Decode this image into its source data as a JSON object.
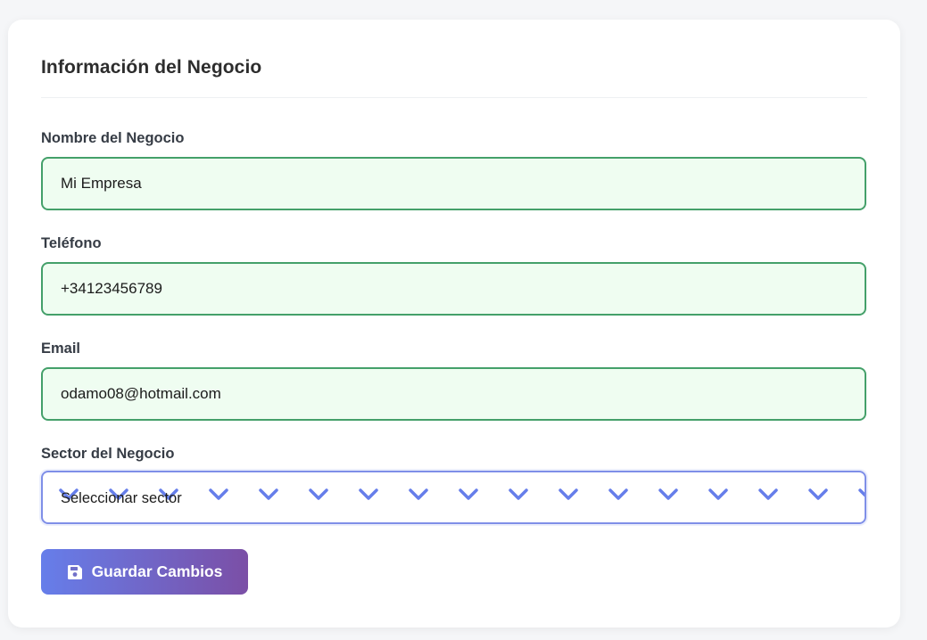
{
  "card": {
    "title": "Información del Negocio"
  },
  "fields": {
    "business_name": {
      "label": "Nombre del Negocio",
      "value": "Mi Empresa"
    },
    "phone": {
      "label": "Teléfono",
      "value": "+34123456789"
    },
    "email": {
      "label": "Email",
      "value": "odamo08@hotmail.com"
    },
    "sector": {
      "label": "Sector del Negocio",
      "selected": "Seleccionar sector"
    }
  },
  "actions": {
    "save_label": "Guardar Cambios",
    "save_icon": "floppy-disk-icon"
  },
  "colors": {
    "valid_border": "#44a06a",
    "valid_background": "#effdf1",
    "select_accent": "#667eea",
    "button_gradient_start": "#667eea",
    "button_gradient_end": "#7b4fa6"
  }
}
